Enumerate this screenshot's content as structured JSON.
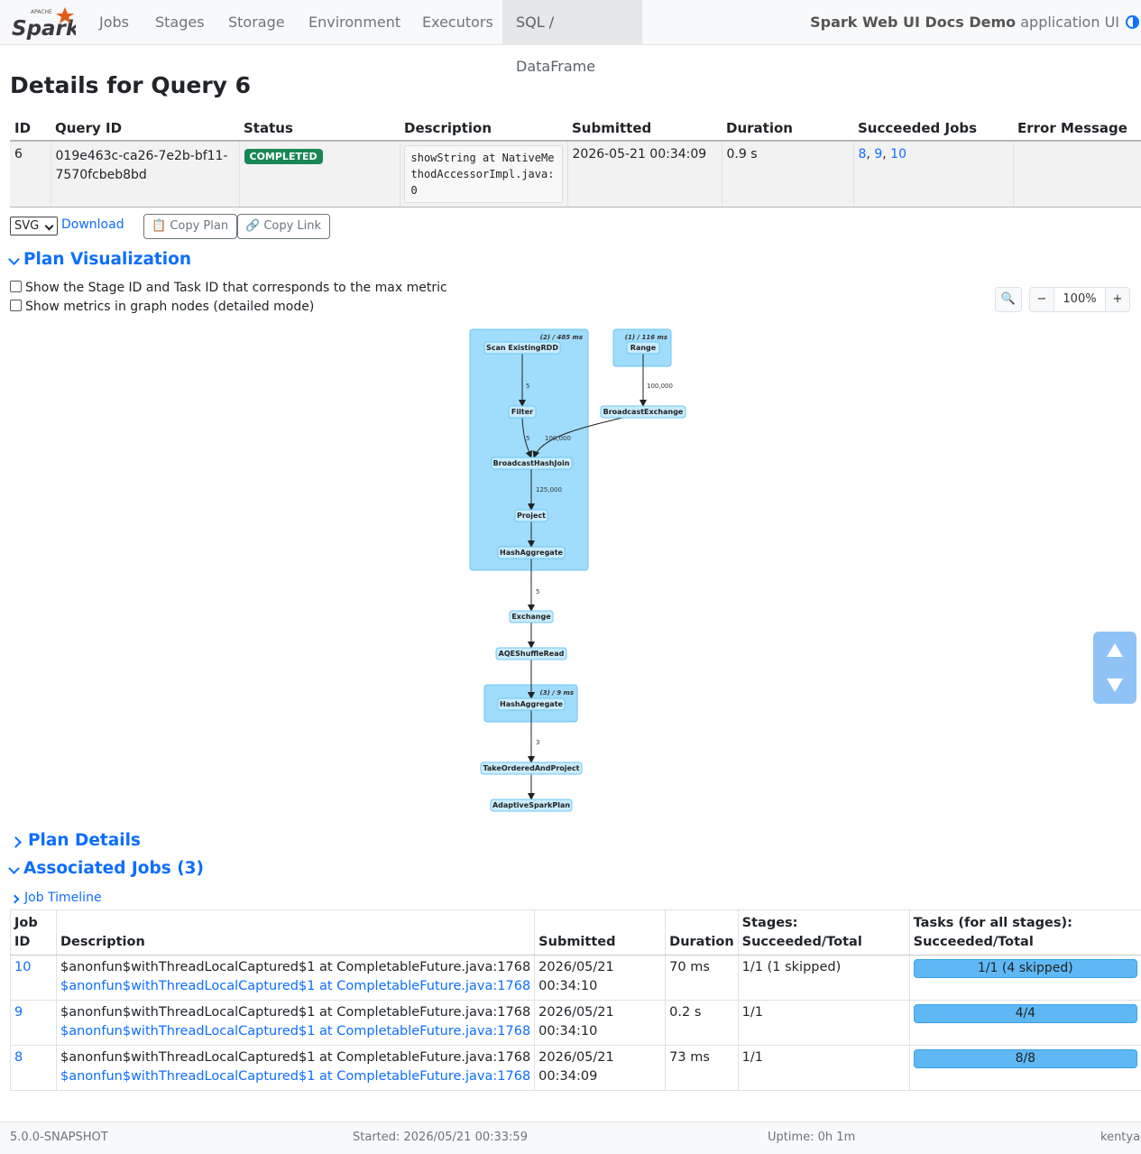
{
  "nav": {
    "logo_small": "APACHE",
    "logo_text": "Spark",
    "tabs": [
      "Jobs",
      "Stages",
      "Storage",
      "Environment",
      "Executors",
      "SQL / DataFrame"
    ],
    "active_tab": "SQL / DataFrame",
    "app_name": "Spark Web UI Docs Demo",
    "app_suffix": " application UI"
  },
  "page_title": "Details for Query 6",
  "query_table": {
    "headers": [
      "ID",
      "Query ID",
      "Status",
      "Description",
      "Submitted",
      "Duration",
      "Succeeded Jobs",
      "Error Message"
    ],
    "row": {
      "id": "6",
      "query_id_1": "019e463c-ca26-7e2b-bf11-",
      "query_id_2": "7570fcbeb8bd",
      "status": "COMPLETED",
      "description": "showString at NativeMethodAccessorImpl.java:0",
      "submitted": "2026-05-21 00:34:09",
      "duration": "0.9 s",
      "succeeded_jobs": [
        "8",
        "9",
        "10"
      ],
      "error_message": ""
    }
  },
  "toolbar": {
    "format": "SVG",
    "download": "Download",
    "copy_plan": "📋 Copy Plan",
    "copy_link": "🔗 Copy Link"
  },
  "plan_visualization": {
    "title": "Plan Visualization",
    "checkbox_stage": "Show the Stage ID and Task ID that corresponds to the max metric",
    "checkbox_metrics": "Show metrics in graph nodes (detailed mode)",
    "zoom_search_icon": "🔍",
    "zoom_out": "−",
    "zoom_level": "100%",
    "zoom_in": "+"
  },
  "plan_graph": {
    "clusters": [
      {
        "label": "(2) / 485 ms"
      },
      {
        "label": "(1) / 116 ms"
      },
      {
        "label": "(3) / 9 ms"
      }
    ],
    "nodes": [
      "Scan ExistingRDD",
      "Range",
      "Filter",
      "BroadcastExchange",
      "BroadcastHashJoin",
      "Project",
      "HashAggregate",
      "Exchange",
      "AQEShuffleRead",
      "HashAggregate",
      "TakeOrderedAndProject",
      "AdaptiveSparkPlan"
    ],
    "edge_labels": [
      "5",
      "100,000",
      "5",
      "100,000",
      "125,000",
      "5",
      "3"
    ]
  },
  "plan_details": {
    "title": "Plan Details"
  },
  "associated_jobs": {
    "title": "Associated Jobs (3)",
    "timeline": "Job Timeline",
    "headers": {
      "job_id_1": "Job",
      "job_id_2": "ID",
      "description": "Description",
      "submitted": "Submitted",
      "duration": "Duration",
      "stages_1": "Stages:",
      "stages_2": "Succeeded/Total",
      "tasks_1": "Tasks (for all stages):",
      "tasks_2": "Succeeded/Total"
    },
    "rows": [
      {
        "id": "10",
        "desc": "$anonfun$withThreadLocalCaptured$1 at CompletableFuture.java:1768",
        "desc_link": "$anonfun$withThreadLocalCaptured$1 at CompletableFuture.java:1768",
        "submitted_date": "2026/05/21",
        "submitted_time": "00:34:10",
        "duration": "70 ms",
        "stages": "1/1 (1 skipped)",
        "tasks": "1/1 (4 skipped)",
        "tasks_progress": 1.0
      },
      {
        "id": "9",
        "desc": "$anonfun$withThreadLocalCaptured$1 at CompletableFuture.java:1768",
        "desc_link": "$anonfun$withThreadLocalCaptured$1 at CompletableFuture.java:1768",
        "submitted_date": "2026/05/21",
        "submitted_time": "00:34:10",
        "duration": "0.2 s",
        "stages": "1/1",
        "tasks": "4/4",
        "tasks_progress": 1.0
      },
      {
        "id": "8",
        "desc": "$anonfun$withThreadLocalCaptured$1 at CompletableFuture.java:1768",
        "desc_link": "$anonfun$withThreadLocalCaptured$1 at CompletableFuture.java:1768",
        "submitted_date": "2026/05/21",
        "submitted_time": "00:34:09",
        "duration": "73 ms",
        "stages": "1/1",
        "tasks": "8/8",
        "tasks_progress": 1.0
      }
    ]
  },
  "footer": {
    "version": "5.0.0-SNAPSHOT",
    "started": "Started: 2026/05/21 00:33:59",
    "uptime": "Uptime: 0h 1m",
    "user": "kentyao"
  },
  "colors": {
    "accent": "#0d6efd",
    "status_completed": "#198754",
    "cluster_fill": "#a0dcfb",
    "node_fill": "#c9ecfd",
    "progress": "#5fb8f4"
  },
  "icons": {
    "theme_toggle": "half-circle-icon",
    "scroll": [
      "scroll-up-icon",
      "scroll-down-icon"
    ]
  }
}
